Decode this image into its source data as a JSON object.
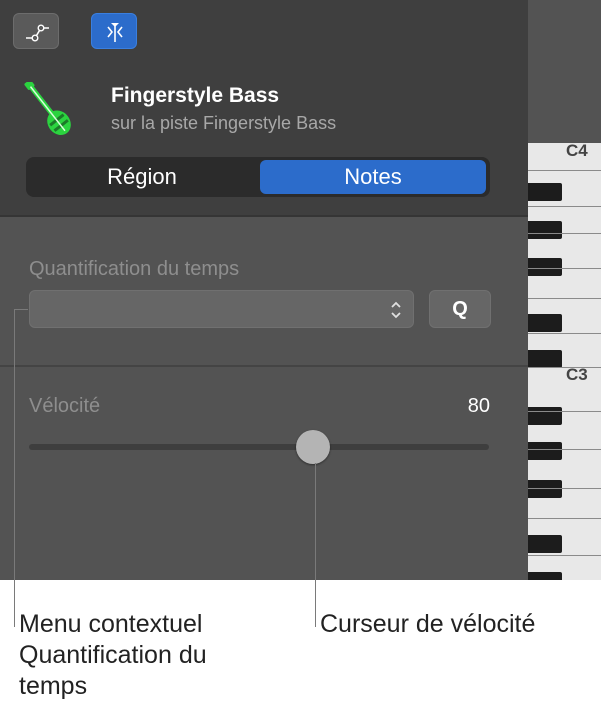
{
  "toolbar": {
    "automation_icon": "automation-curve-icon",
    "editor_icon": "catch-playhead-icon"
  },
  "track": {
    "icon": "bass-guitar-icon",
    "icon_color": "#2bd33f",
    "name": "Fingerstyle Bass",
    "subtitle": "sur la piste Fingerstyle Bass"
  },
  "tabs": [
    {
      "label": "Région",
      "selected": false
    },
    {
      "label": "Notes",
      "selected": true
    }
  ],
  "quantize": {
    "label": "Quantification du temps",
    "value": "",
    "button_label": "Q"
  },
  "velocity": {
    "label": "Vélocité",
    "value": "80",
    "fraction": 0.617
  },
  "piano": {
    "labels": [
      "C4",
      "C3"
    ]
  },
  "captions": {
    "quantize_menu": "Menu contextuel Quantification du temps",
    "velocity_slider": "Curseur de vélocité"
  },
  "colors": {
    "accent": "#2c6ccb",
    "panel": "#535353",
    "header": "#3f3f3f"
  }
}
